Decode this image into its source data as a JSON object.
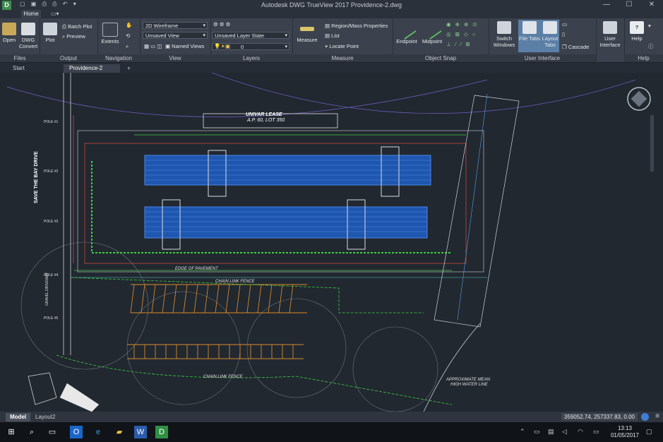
{
  "app": {
    "title": "Autodesk DWG TrueView 2017    Providence-2.dwg",
    "icon_letter": "D",
    "qat_icons": "▢ ▣ ⎙ ⎙ ↶ ▾",
    "win_minimize": "—",
    "win_maximize": "☐",
    "win_close": "✕"
  },
  "ribbon": {
    "home_tab": "Home",
    "panels": {
      "files": {
        "title": "Files",
        "open": "Open",
        "dwg_convert_1": "DWG",
        "dwg_convert_2": "Convert"
      },
      "output": {
        "title": "Output",
        "plot": "Plot",
        "batch_plot": "Batch Plot",
        "preview": "Preview"
      },
      "navigation": {
        "title": "Navigation",
        "extents": "Extents"
      },
      "view": {
        "title": "View",
        "visual_style": "2D Wireframe",
        "saved_view": "Unsaved View",
        "named_views": "Named Views"
      },
      "layers": {
        "title": "Layers",
        "layer_state": "Unsaved Layer State",
        "layer_current": "0"
      },
      "measure": {
        "title": "Measure",
        "measure": "Measure",
        "region_mass": "Region/Mass Properties",
        "list": "List",
        "locate_point": "Locate Point"
      },
      "object_snap": {
        "title": "Object Snap",
        "endpoint": "Endpoint",
        "midpoint": "Midpoint"
      },
      "user_interface": {
        "title": "User Interface",
        "switch_windows_1": "Switch",
        "switch_windows_2": "Windows",
        "file_tabs": "File Tabs",
        "layout_tabs_1": "Layout",
        "layout_tabs_2": "Tabs",
        "cascade": "Cascade",
        "user_interface_1": "User",
        "user_interface_2": "Interface"
      },
      "help": {
        "title": "Help",
        "help": "Help"
      }
    }
  },
  "doc_tabs": {
    "start": "Start",
    "active": "Providence-2",
    "add": "+"
  },
  "drawing": {
    "lease_label_1": "UNIVAR LEASE",
    "lease_label_2": "A.P. 60, LOT 350",
    "edge_of_pavement": "EDGE OF PAVEMENT",
    "chain_link_fence_1": "CHAIN LINK FENCE",
    "chain_link_fence_2": "CHAIN LINK FENCE",
    "approx_mean_1": "APPROXIMATE MEAN",
    "approx_mean_2": "HIGH WATER LINE",
    "save_the_bay_drive": "SAVE THE BAY DRIVE",
    "gravel_driveway": "GRAVEL DRIVEWAY",
    "pole_labels": [
      "POLE #1",
      "POLE #2",
      "POLE #3",
      "POLE #4",
      "POLE #5"
    ]
  },
  "status": {
    "model_tab": "Model",
    "layout_tab": "Layout2",
    "coordinates": "359052.74, 257337.83, 0.00"
  },
  "taskbar": {
    "time": "13:13",
    "date": "01/05/2017"
  }
}
